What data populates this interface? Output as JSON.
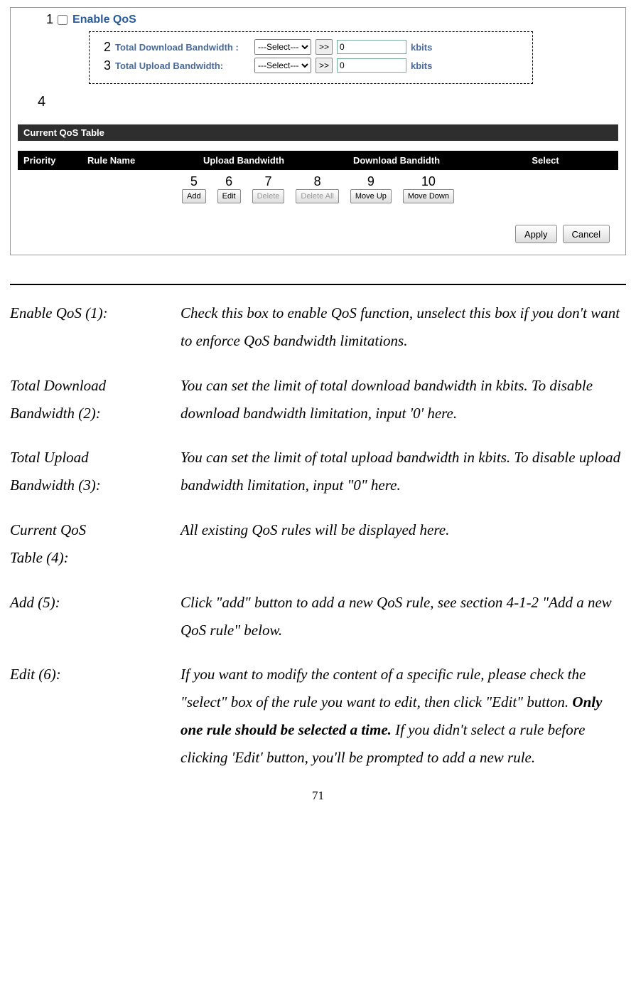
{
  "shot": {
    "enable": {
      "anno": "1",
      "label": "Enable QoS"
    },
    "download": {
      "anno": "2",
      "label": "Total Download Bandwidth :",
      "select": "---Select---",
      "arrow": ">>",
      "value": "0",
      "unit": "kbits"
    },
    "upload": {
      "anno": "3",
      "label": "Total Upload Bandwidth:",
      "select": "---Select---",
      "arrow": ">>",
      "value": "0",
      "unit": "kbits"
    },
    "anno4": "4",
    "section_title": "Current QoS Table",
    "columns": {
      "priority": "Priority",
      "rule": "Rule Name",
      "upload": "Upload Bandwidth",
      "download": "Download Bandidth",
      "select": "Select"
    },
    "buttons": {
      "b5": {
        "anno": "5",
        "label": "Add"
      },
      "b6": {
        "anno": "6",
        "label": "Edit"
      },
      "b7": {
        "anno": "7",
        "label": "Delete"
      },
      "b8": {
        "anno": "8",
        "label": "Delete All"
      },
      "b9": {
        "anno": "9",
        "label": "Move Up"
      },
      "b10": {
        "anno": "10",
        "label": "Move Down"
      }
    },
    "apply": "Apply",
    "cancel": "Cancel"
  },
  "descriptions": {
    "d1": {
      "term": "Enable QoS (1):",
      "def": "Check this box to enable QoS function, unselect this box if you don't want to enforce QoS bandwidth limitations."
    },
    "d2": {
      "term1": "Total Download",
      "term2": "Bandwidth (2):",
      "def": "You can set the limit of total download bandwidth in kbits. To disable download bandwidth limitation, input '0' here."
    },
    "d3": {
      "term1": "Total Upload",
      "term2": "Bandwidth (3):",
      "def": "You can set the limit of total upload bandwidth in kbits. To disable upload bandwidth limitation, input \"0\" here."
    },
    "d4": {
      "term1": "Current QoS",
      "term2": "Table (4):",
      "def": "All existing QoS rules will be displayed here."
    },
    "d5": {
      "term": "Add (5):",
      "def": "Click \"add\" button to add a new QoS rule, see section 4-1-2 \"Add a new QoS rule\" below."
    },
    "d6": {
      "term": "Edit (6):",
      "def_a": "If you want to modify the content of a specific rule, please check the \"select\" box of the rule you want to edit, then click \"Edit\" button. ",
      "def_bold": "Only one rule should be selected a time.",
      "def_b": " If you didn't select a rule before clicking 'Edit' button, you'll be prompted to add a new rule."
    }
  },
  "page_number": "71"
}
